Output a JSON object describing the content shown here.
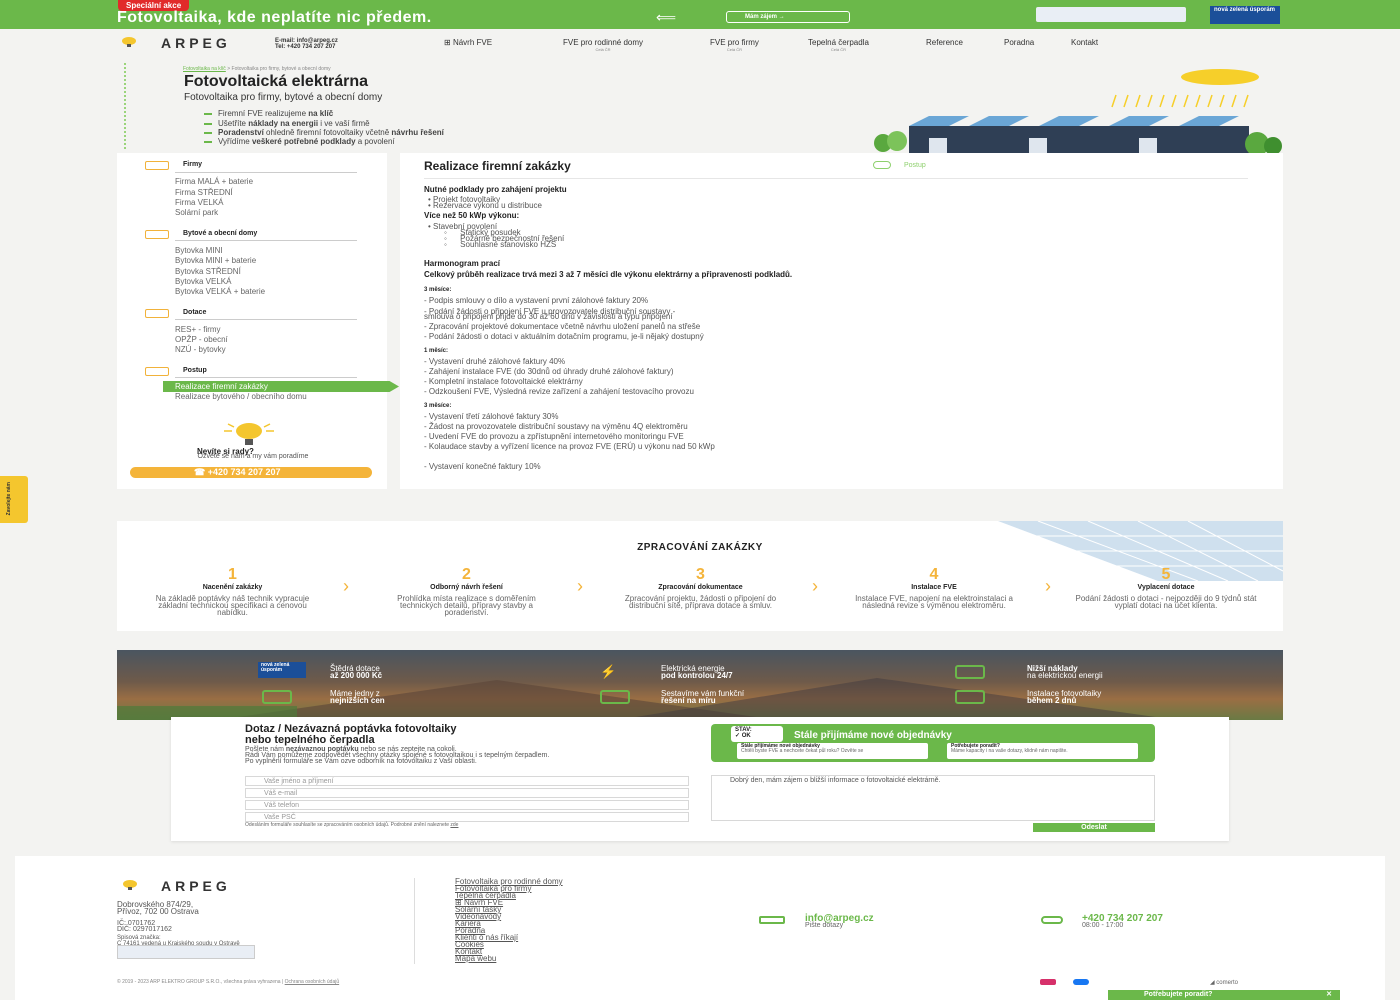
{
  "promo": {
    "badge": "Speciální akce",
    "title": "Fotovoltaika, kde neplatíte nic předem.",
    "button": "Mám zájem",
    "green_badge": "nová zelená úsporám"
  },
  "header": {
    "logo": "ARPEG",
    "email": "E-mail: info@arpeg.cz",
    "phone": "Tel: +420 734 207 207",
    "nav": [
      {
        "label": "Návrh FVE",
        "sub": ""
      },
      {
        "label": "FVE pro rodinné domy",
        "sub": "Celá ČR"
      },
      {
        "label": "FVE pro firmy",
        "sub": "Celá ČR"
      },
      {
        "label": "Tepelná čerpadla",
        "sub": "Celá ČR"
      },
      {
        "label": "Reference",
        "sub": ""
      },
      {
        "label": "Poradna",
        "sub": ""
      },
      {
        "label": "Kontakt",
        "sub": ""
      }
    ]
  },
  "hero": {
    "breadcrumb_link": "Fotovoltaika na klíč",
    "breadcrumb_rest": " > Fotovoltaika pro firmy, bytové a obecní domy",
    "title": "Fotovoltaická elektrárna",
    "subtitle": "Fotovoltaika pro firmy, bytové a obecní domy",
    "bullets": [
      [
        "Firemní FVE realizujeme ",
        "na klíč",
        ""
      ],
      [
        "Ušetříte ",
        "náklady na energii",
        " i ve vaší firmě"
      ],
      [
        "",
        "Poradenství",
        " ohledně firemní fotovoltaiky včetně "
      ],
      [
        "Vyřídíme ",
        "veškeré potřebné podklady",
        " a povolení"
      ]
    ],
    "bullet3_bold2": "návrhu řešení"
  },
  "sidebar": {
    "sections": [
      {
        "title": "Firmy",
        "items": [
          "Firma MALÁ + baterie",
          "Firma STŘEDNÍ",
          "Firma VELKÁ",
          "Solární park"
        ]
      },
      {
        "title": "Bytové a obecní domy",
        "items": [
          "Bytovka MINI",
          "Bytovka MINI + baterie",
          "Bytovka STŘEDNÍ",
          "Bytovka VELKÁ",
          "Bytovka VELKÁ + baterie"
        ]
      },
      {
        "title": "Dotace",
        "items": [
          "RES+ - firmy",
          "OPŽP - obecní",
          "NZÚ - bytovky"
        ]
      },
      {
        "title": "Postup",
        "items": [
          "Realizace firemní zakázky",
          "Realizace bytového / obecního domu"
        ]
      }
    ],
    "help_title": "Nevíte si rady?",
    "help_desc": "Ozvěte se nám a my vám poradíme",
    "phone": "+420 734 207 207"
  },
  "content": {
    "title": "Realizace firemní zakázky",
    "postup": "Postup",
    "req_title": "Nutné podklady pro zahájení projektu",
    "req_items": [
      "Projekt fotovoltaiky",
      "Rezervace výkonu u distribuce"
    ],
    "over_title": "Více než 50 kWp výkonu:",
    "over_item": "Stavební povolení",
    "over_sub": [
      "Statický posudek",
      "Požárně bezpečnostní řešení",
      "Souhlasné stanovisko HZS"
    ],
    "harm_title": "Harmonogram prací",
    "harm_lead": "Celkový průběh realizace trvá mezi 3 až 7 měsíci dle výkonu elektrárny a připravenosti podkladů.",
    "phases": [
      {
        "label": "3 měsíce:",
        "items": [
          "- Podpis smlouvy o dílo a vystavení první zálohové faktury 20%",
          "- Podání žádosti o připojení FVE u provozovatele distribuční soustavy -",
          "  smlouva o připojení přijde do 30 až 60 dnů v závislosti a typu připojení",
          "- Zpracování projektové dokumentace včetně návrhu uložení panelů na střeše",
          "- Podání žádosti o dotaci v aktuálním dotačním programu, je-li nějaký dostupný"
        ]
      },
      {
        "label": "1 měsíc:",
        "items": [
          "- Vystavení druhé zálohové faktury 40%",
          "- Zahájení instalace FVE (do 30dnů od úhrady druhé zálohové faktury)",
          "- Kompletní instalace fotovoltaické elektrárny",
          "- Odzkoušení FVE, Výsledná revize zařízení a zahájení testovacího provozu"
        ]
      },
      {
        "label": "3 měsíce:",
        "items": [
          "- Vystavení třetí zálohové faktury 30%",
          "- Žádost na provozovatele distribuční soustavy na výměnu 4Q elektroměru",
          "- Uvedení FVE do provozu a zpřístupnění internetového monitoringu FVE",
          "- Kolaudace stavby a vyřízení licence na provoz FVE (ERÚ) u výkonu nad 50 kWp",
          "",
          "- Vystavení konečné faktury 10%"
        ]
      }
    ]
  },
  "process": {
    "title": "ZPRACOVÁNÍ ZAKÁZKY",
    "steps": [
      {
        "num": "1",
        "title": "Nacenění zakázky",
        "desc": "Na základě poptávky náš technik vypracuje základní technickou specifikaci a cenovou nabídku."
      },
      {
        "num": "2",
        "title": "Odborný návrh řešení",
        "desc": "Prohlídka místa realizace s doměřením technických detailů, přípravy stavby a poradenství."
      },
      {
        "num": "3",
        "title": "Zpracování dokumentace",
        "desc": "Zpracování projektu, žádosti o připojení do distribuční sítě, příprava dotace a smluv."
      },
      {
        "num": "4",
        "title": "Instalace FVE",
        "desc": "Instalace FVE, napojení na elektroinstalaci a následná revize s výměnou elektroměru."
      },
      {
        "num": "5",
        "title": "Vyplacení dotace",
        "desc": "Podání žádosti o dotaci - nejpozději do 9 týdnů stát vyplatí dotaci na účet klienta."
      }
    ]
  },
  "banner": {
    "badge": "nová zelená úsporám",
    "items": [
      [
        "Štědrá dotace",
        "až 200 000 Kč"
      ],
      [
        "Elektrická energie",
        "pod kontrolou 24/7"
      ],
      [
        "Nižší náklady",
        "na elektrickou energii"
      ],
      [
        "Máme jedny z",
        "nejnižších cen"
      ],
      [
        "Sestavíme vám funkční",
        "řešení na míru"
      ],
      [
        "Instalace fotovoltaiky",
        "během 2 dnů"
      ]
    ]
  },
  "form": {
    "title_l1": "Dotaz / Nezávazná poptávka fotovoltaiky",
    "title_l2": "nebo tepelného čerpadla",
    "desc_1": "Pošlete nám ",
    "desc_bold": "nezávaznou poptávku",
    "desc_2": " nebo se nás zeptejte na cokoli.",
    "desc_3": "Rádi Vám pomůžeme zodpovědět všechny otázky spojené s fotovoltaikou i s tepelným čerpadlem.",
    "desc_4": "Po vyplnění formuláře se Vám ozve odborník na fotovoltaiku z Vaší oblasti.",
    "placeholders": [
      "Vaše jméno a příjmení",
      "Váš e-mail",
      "Váš telefon",
      "Vaše PSČ"
    ],
    "message": "Dobrý den, mám zájem o bližší informace o fotovoltaické elektrárně.",
    "gdpr": "Odesláním formuláře souhlasíte se zpracováním osobních údajů. Podrobné znění naleznete ",
    "gdpr_link": "zde",
    "send": "Odeslat",
    "status_label": "STAV:",
    "status_value": "OK",
    "status_title": "Stále přijímáme nové objednávky",
    "status_boxes": [
      {
        "title": "Stále přijímáme nové objednávky",
        "desc": "Chtěli byste FVE a nechcete čekat půl roku? Ozvěte se"
      },
      {
        "title": "Potřebujete poradit?",
        "desc": "Máme kapacity i na vaše dotazy, klidně nám napište."
      }
    ]
  },
  "footer": {
    "logo": "ARPEG",
    "addr_1": "Dobrovského 874/29,",
    "addr_2": "Přívoz, 702 00 Ostrava",
    "ic": "IČ: 0701762",
    "dic": "DIČ: 0297017162",
    "reg_1": "Spisová značka:",
    "reg_2": "C 74161 vedená u Krajského soudu v Ostravě",
    "links": [
      "Fotovoltaika pro rodinné domy",
      "Fotovoltaika pro firmy",
      "Tepelná čerpadla",
      "Návrh FVE",
      "Solární tašky",
      "Videonávody",
      "Kariéra",
      "Poradna",
      "Klienti o nás říkají",
      "Cookies",
      "Kontakt",
      "Mapa webu"
    ],
    "email": "info@arpeg.cz",
    "email_sub": "Pište dotazy",
    "phone": "+420 734 207 207",
    "phone_sub": "08:00 - 17:00",
    "copy": "© 2019 - 2023 ARP ELEKTRO GROUP S.R.O., všechna práva vyhrazena | ",
    "copy_link": "Ochrana osobních údajů",
    "comerto": "comerto",
    "help_bar": "Potřebujete poradit?"
  },
  "side_tab": "Zavolejte nám"
}
